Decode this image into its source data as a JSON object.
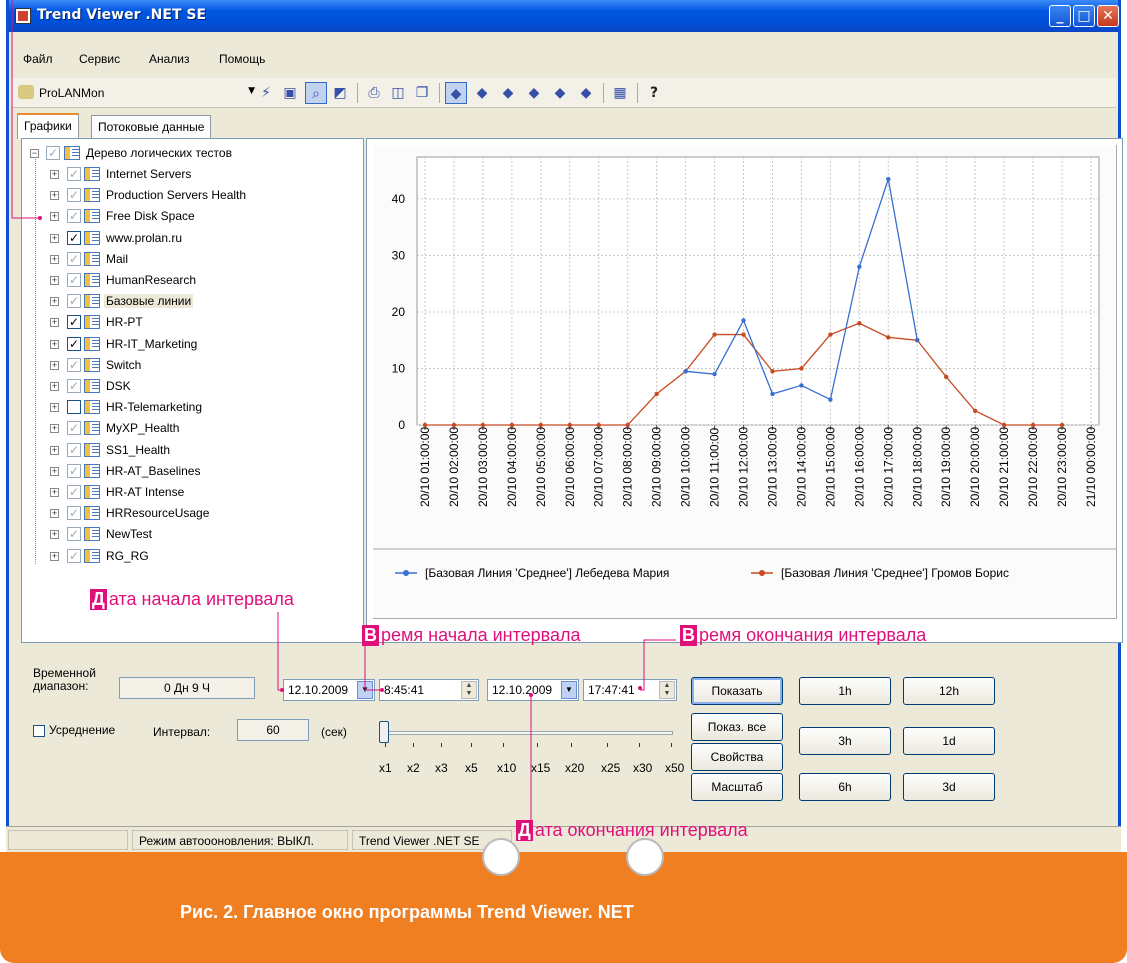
{
  "window": {
    "title": "Trend Viewer .NET SE",
    "controls": [
      "_",
      "□",
      "✕"
    ]
  },
  "menu": [
    "Файл",
    "Сервис",
    "Анализ",
    "Помощь"
  ],
  "toolbar": {
    "source": "ProLANMon"
  },
  "tabs": [
    "Графики",
    "Потоковые данные"
  ],
  "tree": {
    "root": "Дерево логических тестов",
    "items": [
      {
        "label": "Internet Servers",
        "checked": "✓"
      },
      {
        "label": "Production Servers Health",
        "checked": "✓"
      },
      {
        "label": "Free Disk Space",
        "checked": "✓"
      },
      {
        "label": "www.prolan.ru",
        "checked": "✓"
      },
      {
        "label": "Mail",
        "checked": "✓"
      },
      {
        "label": "HumanResearch",
        "checked": "✓"
      },
      {
        "label": "Базовые линии",
        "checked": "✓"
      },
      {
        "label": "HR-PT",
        "checked": "✓"
      },
      {
        "label": "HR-IT_Marketing",
        "checked": "✓"
      },
      {
        "label": "Switch",
        "checked": "✓"
      },
      {
        "label": "DSK",
        "checked": "✓"
      },
      {
        "label": "HR-Telemarketing",
        "checked": ""
      },
      {
        "label": "MyXP_Health",
        "checked": "✓"
      },
      {
        "label": "SS1_Health",
        "checked": "✓"
      },
      {
        "label": "HR-AT_Baselines",
        "checked": "✓"
      },
      {
        "label": "HR-AT Intense",
        "checked": "✓"
      },
      {
        "label": "HRResourceUsage",
        "checked": "✓"
      },
      {
        "label": "NewTest",
        "checked": "✓"
      },
      {
        "label": "RG_RG",
        "checked": "✓"
      }
    ]
  },
  "chart_data": {
    "type": "line",
    "x": [
      "20/10 01:00:00",
      "20/10 02:00:00",
      "20/10 03:00:00",
      "20/10 04:00:00",
      "20/10 05:00:00",
      "20/10 06:00:00",
      "20/10 07:00:00",
      "20/10 08:00:00",
      "20/10 09:00:00",
      "20/10 10:00:00",
      "20/10 11:00:00",
      "20/10 12:00:00",
      "20/10 13:00:00",
      "20/10 14:00:00",
      "20/10 15:00:00",
      "20/10 16:00:00",
      "20/10 17:00:00",
      "20/10 18:00:00",
      "20/10 19:00:00",
      "20/10 20:00:00",
      "20/10 21:00:00",
      "20/10 22:00:00",
      "20/10 23:00:00",
      "21/10 00:00:00"
    ],
    "yticks": [
      0,
      10,
      20,
      30,
      40
    ],
    "ylim": [
      0,
      46
    ],
    "series": [
      {
        "name": "[Базовая Линия 'Среднее'] Лебедева Мария",
        "color": "#3a6fd0",
        "points": [
          [
            9,
            9.5
          ],
          [
            10,
            9
          ],
          [
            11,
            18.5
          ],
          [
            12,
            5.5
          ],
          [
            13,
            7
          ],
          [
            14,
            4.5
          ],
          [
            15,
            28
          ],
          [
            16,
            43.5
          ],
          [
            17,
            15
          ]
        ]
      },
      {
        "name": "[Базовая Линия 'Среднее'] Громов Борис",
        "color": "#c84a20",
        "points": [
          [
            0,
            0
          ],
          [
            1,
            0
          ],
          [
            2,
            0
          ],
          [
            3,
            0
          ],
          [
            4,
            0
          ],
          [
            5,
            0
          ],
          [
            6,
            0
          ],
          [
            7,
            0
          ],
          [
            8,
            5.5
          ],
          [
            9,
            9.5
          ],
          [
            10,
            16
          ],
          [
            11,
            16
          ],
          [
            12,
            9.5
          ],
          [
            13,
            10
          ],
          [
            14,
            16
          ],
          [
            15,
            18
          ],
          [
            16,
            15.5
          ],
          [
            17,
            15
          ],
          [
            18,
            8.5
          ],
          [
            19,
            2.5
          ],
          [
            20,
            0
          ],
          [
            21,
            0
          ],
          [
            22,
            0
          ]
        ]
      }
    ],
    "grid": true,
    "legend": "bottom"
  },
  "controls": {
    "range_label": "Временной диапазон:",
    "range_value": "0 Дн 9 Ч",
    "start_date": "12.10.2009",
    "start_time": "8:45:41",
    "end_date": "12.10.2009",
    "end_time": "17:47:41",
    "averaging_label": "Усреднение",
    "interval_label": "Интервал:",
    "interval_value": "60",
    "interval_unit": "(сек)",
    "multipliers": [
      "x1",
      "x2",
      "x3",
      "x5",
      "x10",
      "x15",
      "x20",
      "x25",
      "x30",
      "x50"
    ],
    "buttons": {
      "show": "Показать",
      "show_all": "Показ. все",
      "properties": "Свойства",
      "scale": "Масштаб"
    },
    "quick": [
      "1h",
      "12h",
      "3h",
      "1d",
      "6h",
      "3d"
    ]
  },
  "status": {
    "autoupdate": "Режим автоооновления: ВЫКЛ.",
    "app": "Trend Viewer .NET SE"
  },
  "annotations": {
    "start_date": [
      "Д",
      "ата начала интервала"
    ],
    "start_time": [
      "В",
      "ремя начала интервала"
    ],
    "end_time": [
      "В",
      "ремя окончания интервала"
    ],
    "end_date": [
      "Д",
      "ата окончания интервала"
    ]
  },
  "caption": "Рис. 2. Главное окно программы Trend Viewer. NET"
}
